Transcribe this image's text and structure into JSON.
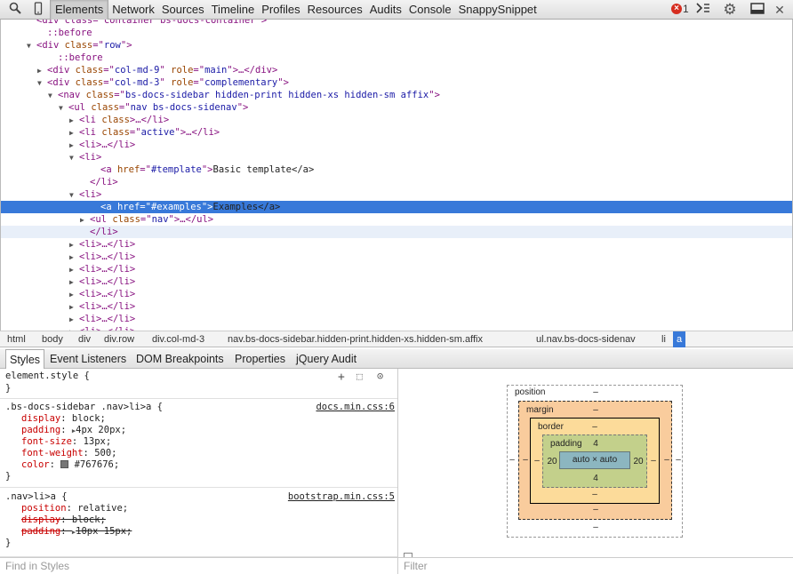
{
  "toolbar": {
    "tabs": [
      "Elements",
      "Network",
      "Sources",
      "Timeline",
      "Profiles",
      "Resources",
      "Audits",
      "Console",
      "SnappySnippet"
    ],
    "error_count": "1",
    "icons": [
      "search-icon",
      "device-icon",
      "drawer-icon",
      "gear-icon",
      "dock-icon",
      "close-icon"
    ]
  },
  "dom_tree": [
    {
      "tag": "div",
      "attrs": [
        [
          "class",
          "container bs-docs-container"
        ]
      ],
      "tail": ">",
      "arrow": "",
      "pseudo": "",
      "text": "<div class=\"container bs-docs-container\">"
    },
    {
      "pseudo": "::before"
    },
    {
      "open": "div",
      "attrs": [
        [
          "class",
          "row"
        ]
      ],
      "tail": "",
      "arrow": "open"
    },
    {
      "pseudo": "::before"
    },
    {
      "open": "div",
      "attrs": [
        [
          "class",
          "col-md-9"
        ],
        [
          "role",
          "main"
        ]
      ],
      "tail": "…</div>",
      "arrow": "closed"
    },
    {
      "open": "div",
      "attrs": [
        [
          "class",
          "col-md-3"
        ],
        [
          "role",
          "complementary"
        ]
      ],
      "tail": "",
      "arrow": "open"
    },
    {
      "open": "nav",
      "attrs": [
        [
          "class",
          "bs-docs-sidebar hidden-print hidden-xs hidden-sm affix"
        ]
      ],
      "tail": "",
      "arrow": "open"
    },
    {
      "open": "ul",
      "attrs": [
        [
          "class",
          "nav bs-docs-sidenav"
        ]
      ],
      "tail": "",
      "arrow": "open"
    },
    {
      "open": "li",
      "attrs": [
        [
          "class",
          ""
        ]
      ],
      "tail": "…</li>",
      "arrow": "closed",
      "attr_only_name": true
    },
    {
      "open": "li",
      "attrs": [
        [
          "class",
          "active"
        ]
      ],
      "tail": "…</li>",
      "arrow": "closed"
    },
    {
      "open": "li",
      "attrs": [],
      "tail": "…</li>",
      "arrow": "closed"
    },
    {
      "open": "li",
      "attrs": [],
      "tail": "",
      "arrow": "open"
    },
    {
      "open": "a",
      "attrs": [
        [
          "href",
          "#template"
        ]
      ],
      "tail": "Basic template</a>",
      "arrow": ""
    },
    {
      "close": "li"
    },
    {
      "open": "li",
      "attrs": [],
      "tail": "",
      "arrow": "open"
    },
    {
      "open": "a",
      "attrs": [
        [
          "href",
          "#examples"
        ]
      ],
      "tail": "Examples</a>",
      "arrow": "",
      "selected": true
    },
    {
      "open": "ul",
      "attrs": [
        [
          "class",
          "nav"
        ]
      ],
      "tail": "…</ul>",
      "arrow": "closed"
    },
    {
      "close": "li",
      "hover": true
    },
    {
      "open": "li",
      "attrs": [],
      "tail": "…</li>",
      "arrow": "closed"
    },
    {
      "open": "li",
      "attrs": [],
      "tail": "…</li>",
      "arrow": "closed"
    },
    {
      "open": "li",
      "attrs": [],
      "tail": "…</li>",
      "arrow": "closed"
    },
    {
      "open": "li",
      "attrs": [],
      "tail": "…</li>",
      "arrow": "closed"
    },
    {
      "open": "li",
      "attrs": [],
      "tail": "…</li>",
      "arrow": "closed"
    },
    {
      "open": "li",
      "attrs": [],
      "tail": "…</li>",
      "arrow": "closed"
    },
    {
      "open": "li",
      "attrs": [],
      "tail": "…</li>",
      "arrow": "closed"
    },
    {
      "open": "li",
      "attrs": [],
      "tail": "…</li>",
      "arrow": "closed"
    }
  ],
  "breadcrumb": [
    "html",
    "body",
    "div",
    "div.row",
    "div.col-md-3",
    "nav.bs-docs-sidebar.hidden-print.hidden-xs.hidden-sm.affix",
    "ul.nav.bs-docs-sidenav",
    "li",
    "a"
  ],
  "sub_tabs": [
    "Styles",
    "Event Listeners",
    "DOM Breakpoints",
    "Properties",
    "jQuery Audit"
  ],
  "styles": {
    "element_style": {
      "selector": "element.style {",
      "close": "}"
    },
    "rule1": {
      "selector": ".bs-docs-sidebar .nav>li>a {",
      "source": "docs.min.css:6",
      "props": [
        {
          "name": "display",
          "value": "block;"
        },
        {
          "name": "padding",
          "value": "4px 20px;",
          "expandable": true
        },
        {
          "name": "font-size",
          "value": "13px;"
        },
        {
          "name": "font-weight",
          "value": "500;"
        },
        {
          "name": "color",
          "value": "#767676;",
          "swatch": "#767676"
        }
      ],
      "close": "}"
    },
    "rule2": {
      "selector": ".nav>li>a {",
      "source": "bootstrap.min.css:5",
      "props": [
        {
          "name": "position",
          "value": "relative;"
        },
        {
          "name": "display",
          "value": "block;",
          "struck": true
        },
        {
          "name": "padding",
          "value": "10px 15px;",
          "struck": true,
          "expandable": true
        }
      ],
      "close": "}"
    }
  },
  "metrics": {
    "position_label": "position",
    "margin_label": "margin",
    "border_label": "border",
    "padding_label": "padding",
    "position": {
      "top": "–",
      "bottom": "–",
      "left": "–",
      "right": "–"
    },
    "margin": {
      "top": "–",
      "bottom": "–",
      "left": "–",
      "right": "–"
    },
    "border": {
      "top": "–",
      "bottom": "–",
      "left": "–",
      "right": "–"
    },
    "padding": {
      "top": "4",
      "bottom": "4",
      "left": "20",
      "right": "20"
    },
    "content": "auto × auto",
    "colors": {
      "margin": "#f9cc9d",
      "border": "#fcdb9a",
      "padding": "#c3d08b",
      "content": "#8cb6c0"
    }
  },
  "find_in_styles": {
    "placeholder": "Find in Styles"
  },
  "filter": {
    "placeholder": "Filter"
  }
}
